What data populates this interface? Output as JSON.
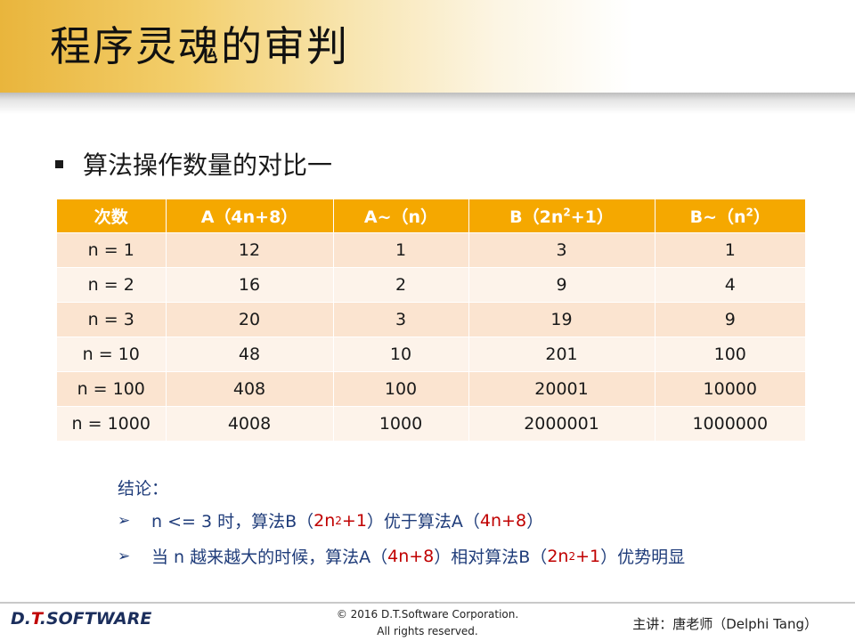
{
  "title": "程序灵魂的审判",
  "bullet": "算法操作数量的对比一",
  "table": {
    "headers": [
      {
        "main": "次数",
        "sup": "",
        "rest": ""
      },
      {
        "main": "A（4n+8）",
        "sup": "",
        "rest": ""
      },
      {
        "main": "A~（n）",
        "sup": "",
        "rest": ""
      },
      {
        "main": "B（2n",
        "sup": "2",
        "rest": "+1）"
      },
      {
        "main": "B~（n",
        "sup": "2",
        "rest": "）"
      }
    ],
    "rows": [
      [
        "n = 1",
        "12",
        "1",
        "3",
        "1"
      ],
      [
        "n = 2",
        "16",
        "2",
        "9",
        "4"
      ],
      [
        "n = 3",
        "20",
        "3",
        "19",
        "9"
      ],
      [
        "n = 10",
        "48",
        "10",
        "201",
        "100"
      ],
      [
        "n = 100",
        "408",
        "100",
        "20001",
        "10000"
      ],
      [
        "n = 1000",
        "4008",
        "1000",
        "2000001",
        "1000000"
      ]
    ]
  },
  "conclusion": {
    "label": "结论：",
    "item1": {
      "a": "n <= 3 时，算法B（",
      "b": "2n",
      "sup": "2",
      "c": "+1",
      "d": "）优于算法A（",
      "e": "4n+8",
      "f": "）"
    },
    "item2": {
      "a": "当 n 越来越大的时候，算法A（",
      "b": "4n+8",
      "c": "）相对算法B（",
      "d": "2n",
      "sup": "2",
      "e": "+1",
      "f": "）优势明显"
    }
  },
  "footer": {
    "logo_a": "D.",
    "logo_t": "T",
    "logo_b": ".SOFTWARE",
    "copyright_line1": "© 2016 D.T.Software Corporation.",
    "copyright_line2": "All rights reserved.",
    "presenter": "主讲：唐老师（Delphi Tang）"
  }
}
